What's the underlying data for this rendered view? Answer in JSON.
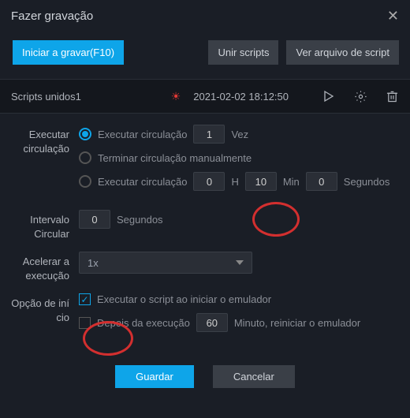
{
  "titlebar": {
    "title": "Fazer gravação"
  },
  "toolbar": {
    "start_record": "Iniciar a gravar(F10)",
    "merge_scripts": "Unir scripts",
    "view_script_file": "Ver arquivo de script"
  },
  "current_script": {
    "name": "Scripts unidos1",
    "timestamp": "2021-02-02 18:12:50"
  },
  "form": {
    "exec_loop_label": "Executar circulação",
    "opt_loop_label": "Executar circulação",
    "loop_count": "1",
    "times_label": "Vez",
    "opt_manual_label": "Terminar circulação manualmente",
    "opt_duration_label": "Executar circulação",
    "h": "0",
    "h_label": "H",
    "min": "10",
    "min_label": "Min",
    "sec": "0",
    "sec_label": "Segundos",
    "interval_label": "Intervalo Circular",
    "interval_val": "0",
    "interval_unit": "Segundos",
    "accel_label": "Acelerar a execução",
    "accel_val": "1x",
    "start_opt_label": "Opção de iní cio",
    "run_on_emulator_start": "Executar o script ao iniciar o emulador",
    "after_exec_label": "Depois da execução",
    "after_exec_val": "60",
    "after_exec_unit": "Minuto, reiniciar o emulador"
  },
  "footer": {
    "save": "Guardar",
    "cancel": "Cancelar"
  }
}
